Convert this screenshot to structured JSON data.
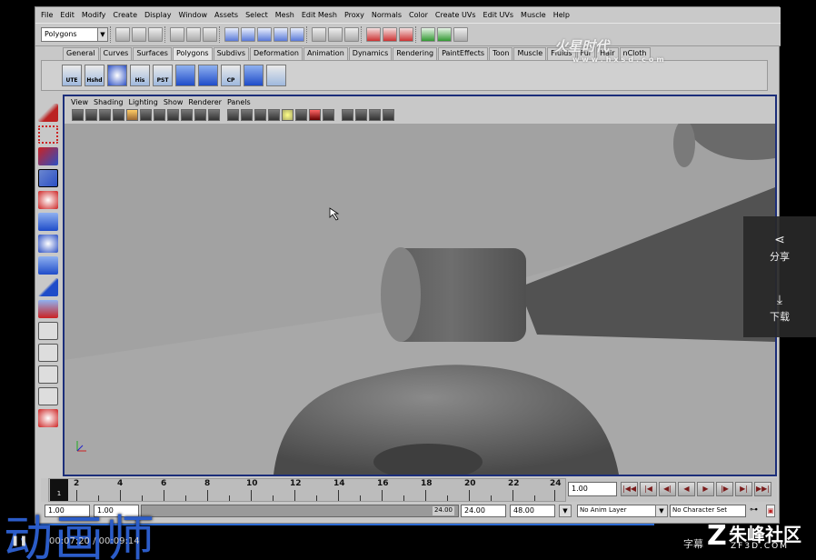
{
  "menubar": [
    "File",
    "Edit",
    "Modify",
    "Create",
    "Display",
    "Window",
    "Assets",
    "Select",
    "Mesh",
    "Edit Mesh",
    "Proxy",
    "Normals",
    "Color",
    "Create UVs",
    "Edit UVs",
    "Muscle",
    "Help"
  ],
  "statusline": {
    "mode": "Polygons"
  },
  "shelf_tabs": [
    "General",
    "Curves",
    "Surfaces",
    "Polygons",
    "Subdivs",
    "Deformation",
    "Animation",
    "Dynamics",
    "Rendering",
    "PaintEffects",
    "Toon",
    "Muscle",
    "Fluids",
    "Fur",
    "Hair",
    "nCloth"
  ],
  "shelf_buttons": [
    "UTE",
    "Hshd",
    "",
    "His",
    "PST",
    "",
    "",
    "CP",
    "",
    ""
  ],
  "watermark": {
    "main": "火星时代",
    "sub": "www.hxsd.com"
  },
  "panel_menu": [
    "View",
    "Shading",
    "Lighting",
    "Show",
    "Renderer",
    "Panels"
  ],
  "timeline": {
    "ticks": [
      "2",
      "4",
      "6",
      "8",
      "10",
      "12",
      "14",
      "16",
      "18",
      "20",
      "22",
      "24"
    ],
    "current_marker": "1",
    "current_frame": "1.00"
  },
  "range": {
    "start": "1.00",
    "playback_start": "1.00",
    "handle_label": "24.00",
    "playback_end": "24.00",
    "end": "48.00",
    "anim_layer": "No Anim Layer",
    "char_set": "No Character Set"
  },
  "side_panel": {
    "share": "分享",
    "download": "下载"
  },
  "overlay": {
    "title": "动画师",
    "time": "00:07:20 / 00:09:14",
    "subtitle": "字幕",
    "logo_name": "朱峰社区",
    "logo_url": "ZF3D.COM"
  },
  "colors": {
    "viewport_border": "#1c2e7a",
    "progress": "#2d6cd6",
    "title": "#2b5cc8"
  }
}
